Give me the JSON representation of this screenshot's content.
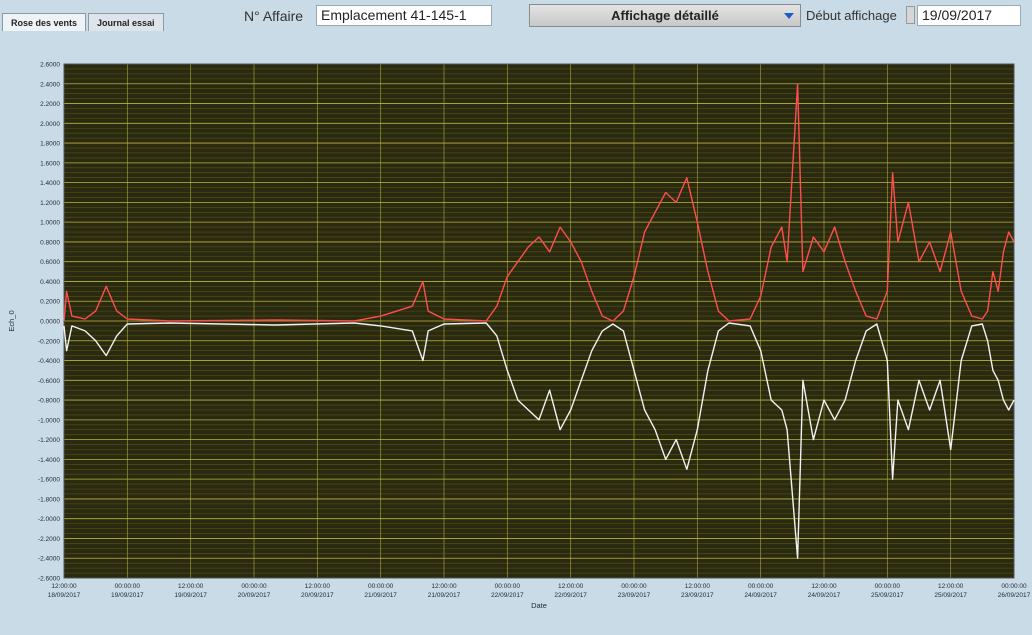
{
  "tabs": [
    {
      "label": "Rose des vents",
      "active": true
    },
    {
      "label": "Journal essai",
      "active": false
    }
  ],
  "affaire": {
    "label": "N° Affaire",
    "value": "Emplacement 41-145-1"
  },
  "display_mode": {
    "value": "Affichage détaillé",
    "arrow_color": "#1a5fc8"
  },
  "debut": {
    "label": "Début affichage",
    "value": "19/09/2017"
  },
  "colors": {
    "plot_background": "#2a2a10",
    "grid_major": "#b8b23a",
    "grid_minor": "#7a7520",
    "series_pos": "#ff4d4d",
    "series_neg": "#f2f2f2"
  },
  "chart_data": {
    "type": "line",
    "title": "",
    "xlabel": "Date",
    "ylabel": "Ech_0",
    "ylim": [
      -2.6,
      2.6
    ],
    "ytick_step": 0.2,
    "grid": true,
    "xtick_labels": [
      [
        "12:00:00",
        "18/09/2017"
      ],
      [
        "00:00:00",
        "19/09/2017"
      ],
      [
        "12:00:00",
        "19/09/2017"
      ],
      [
        "00:00:00",
        "20/09/2017"
      ],
      [
        "12:00:00",
        "20/09/2017"
      ],
      [
        "00:00:00",
        "21/09/2017"
      ],
      [
        "12:00:00",
        "21/09/2017"
      ],
      [
        "00:00:00",
        "22/09/2017"
      ],
      [
        "12:00:00",
        "22/09/2017"
      ],
      [
        "00:00:00",
        "23/09/2017"
      ],
      [
        "12:00:00",
        "23/09/2017"
      ],
      [
        "00:00:00",
        "24/09/2017"
      ],
      [
        "12:00:00",
        "24/09/2017"
      ],
      [
        "00:00:00",
        "25/09/2017"
      ],
      [
        "12:00:00",
        "25/09/2017"
      ],
      [
        "00:00:00",
        "26/09/2017"
      ]
    ],
    "xlim_hours": [
      0,
      180
    ],
    "series": [
      {
        "color": "#ff4d4d",
        "points": [
          [
            0,
            0.0
          ],
          [
            0.5,
            0.3
          ],
          [
            1.5,
            0.05
          ],
          [
            4,
            0.02
          ],
          [
            6,
            0.1
          ],
          [
            8,
            0.35
          ],
          [
            10,
            0.1
          ],
          [
            12,
            0.02
          ],
          [
            20,
            0.0
          ],
          [
            40,
            0.01
          ],
          [
            55,
            0.0
          ],
          [
            60,
            0.05
          ],
          [
            66,
            0.15
          ],
          [
            68,
            0.4
          ],
          [
            69,
            0.1
          ],
          [
            72,
            0.02
          ],
          [
            80,
            0.0
          ],
          [
            82,
            0.15
          ],
          [
            84,
            0.45
          ],
          [
            88,
            0.75
          ],
          [
            90,
            0.85
          ],
          [
            92,
            0.7
          ],
          [
            94,
            0.95
          ],
          [
            96,
            0.8
          ],
          [
            98,
            0.6
          ],
          [
            100,
            0.3
          ],
          [
            102,
            0.05
          ],
          [
            104,
            0.0
          ],
          [
            106,
            0.1
          ],
          [
            108,
            0.45
          ],
          [
            110,
            0.9
          ],
          [
            112,
            1.1
          ],
          [
            114,
            1.3
          ],
          [
            116,
            1.2
          ],
          [
            118,
            1.45
          ],
          [
            120,
            1.0
          ],
          [
            122,
            0.5
          ],
          [
            124,
            0.1
          ],
          [
            126,
            0.0
          ],
          [
            130,
            0.02
          ],
          [
            132,
            0.25
          ],
          [
            134,
            0.75
          ],
          [
            136,
            0.95
          ],
          [
            137,
            0.6
          ],
          [
            139,
            2.4
          ],
          [
            140,
            0.5
          ],
          [
            142,
            0.85
          ],
          [
            144,
            0.7
          ],
          [
            146,
            0.95
          ],
          [
            148,
            0.6
          ],
          [
            150,
            0.3
          ],
          [
            152,
            0.05
          ],
          [
            154,
            0.02
          ],
          [
            156,
            0.3
          ],
          [
            157,
            1.5
          ],
          [
            158,
            0.8
          ],
          [
            160,
            1.2
          ],
          [
            162,
            0.6
          ],
          [
            164,
            0.8
          ],
          [
            166,
            0.5
          ],
          [
            168,
            0.9
          ],
          [
            170,
            0.3
          ],
          [
            172,
            0.05
          ],
          [
            174,
            0.02
          ],
          [
            175,
            0.1
          ],
          [
            176,
            0.5
          ],
          [
            177,
            0.3
          ],
          [
            178,
            0.7
          ],
          [
            179,
            0.9
          ],
          [
            180,
            0.8
          ]
        ]
      },
      {
        "color": "#f2f2f2",
        "points": [
          [
            0,
            -0.05
          ],
          [
            0.5,
            -0.3
          ],
          [
            1.5,
            -0.05
          ],
          [
            4,
            -0.1
          ],
          [
            6,
            -0.2
          ],
          [
            8,
            -0.35
          ],
          [
            10,
            -0.15
          ],
          [
            12,
            -0.03
          ],
          [
            20,
            -0.02
          ],
          [
            40,
            -0.04
          ],
          [
            55,
            -0.02
          ],
          [
            60,
            -0.05
          ],
          [
            66,
            -0.1
          ],
          [
            68,
            -0.4
          ],
          [
            69,
            -0.1
          ],
          [
            72,
            -0.03
          ],
          [
            80,
            -0.02
          ],
          [
            82,
            -0.15
          ],
          [
            84,
            -0.5
          ],
          [
            86,
            -0.8
          ],
          [
            88,
            -0.9
          ],
          [
            90,
            -1.0
          ],
          [
            92,
            -0.7
          ],
          [
            94,
            -1.1
          ],
          [
            96,
            -0.9
          ],
          [
            98,
            -0.6
          ],
          [
            100,
            -0.3
          ],
          [
            102,
            -0.1
          ],
          [
            104,
            -0.03
          ],
          [
            106,
            -0.1
          ],
          [
            108,
            -0.5
          ],
          [
            110,
            -0.9
          ],
          [
            112,
            -1.1
          ],
          [
            114,
            -1.4
          ],
          [
            116,
            -1.2
          ],
          [
            118,
            -1.5
          ],
          [
            120,
            -1.1
          ],
          [
            122,
            -0.5
          ],
          [
            124,
            -0.1
          ],
          [
            126,
            -0.02
          ],
          [
            130,
            -0.05
          ],
          [
            132,
            -0.3
          ],
          [
            134,
            -0.8
          ],
          [
            136,
            -0.9
          ],
          [
            137,
            -1.1
          ],
          [
            139,
            -2.4
          ],
          [
            140,
            -0.6
          ],
          [
            142,
            -1.2
          ],
          [
            144,
            -0.8
          ],
          [
            146,
            -1.0
          ],
          [
            148,
            -0.8
          ],
          [
            150,
            -0.4
          ],
          [
            152,
            -0.1
          ],
          [
            154,
            -0.03
          ],
          [
            156,
            -0.4
          ],
          [
            157,
            -1.6
          ],
          [
            158,
            -0.8
          ],
          [
            160,
            -1.1
          ],
          [
            162,
            -0.6
          ],
          [
            164,
            -0.9
          ],
          [
            166,
            -0.6
          ],
          [
            168,
            -1.3
          ],
          [
            170,
            -0.4
          ],
          [
            172,
            -0.05
          ],
          [
            174,
            -0.03
          ],
          [
            175,
            -0.2
          ],
          [
            176,
            -0.5
          ],
          [
            177,
            -0.6
          ],
          [
            178,
            -0.8
          ],
          [
            179,
            -0.9
          ],
          [
            180,
            -0.8
          ]
        ]
      }
    ]
  }
}
